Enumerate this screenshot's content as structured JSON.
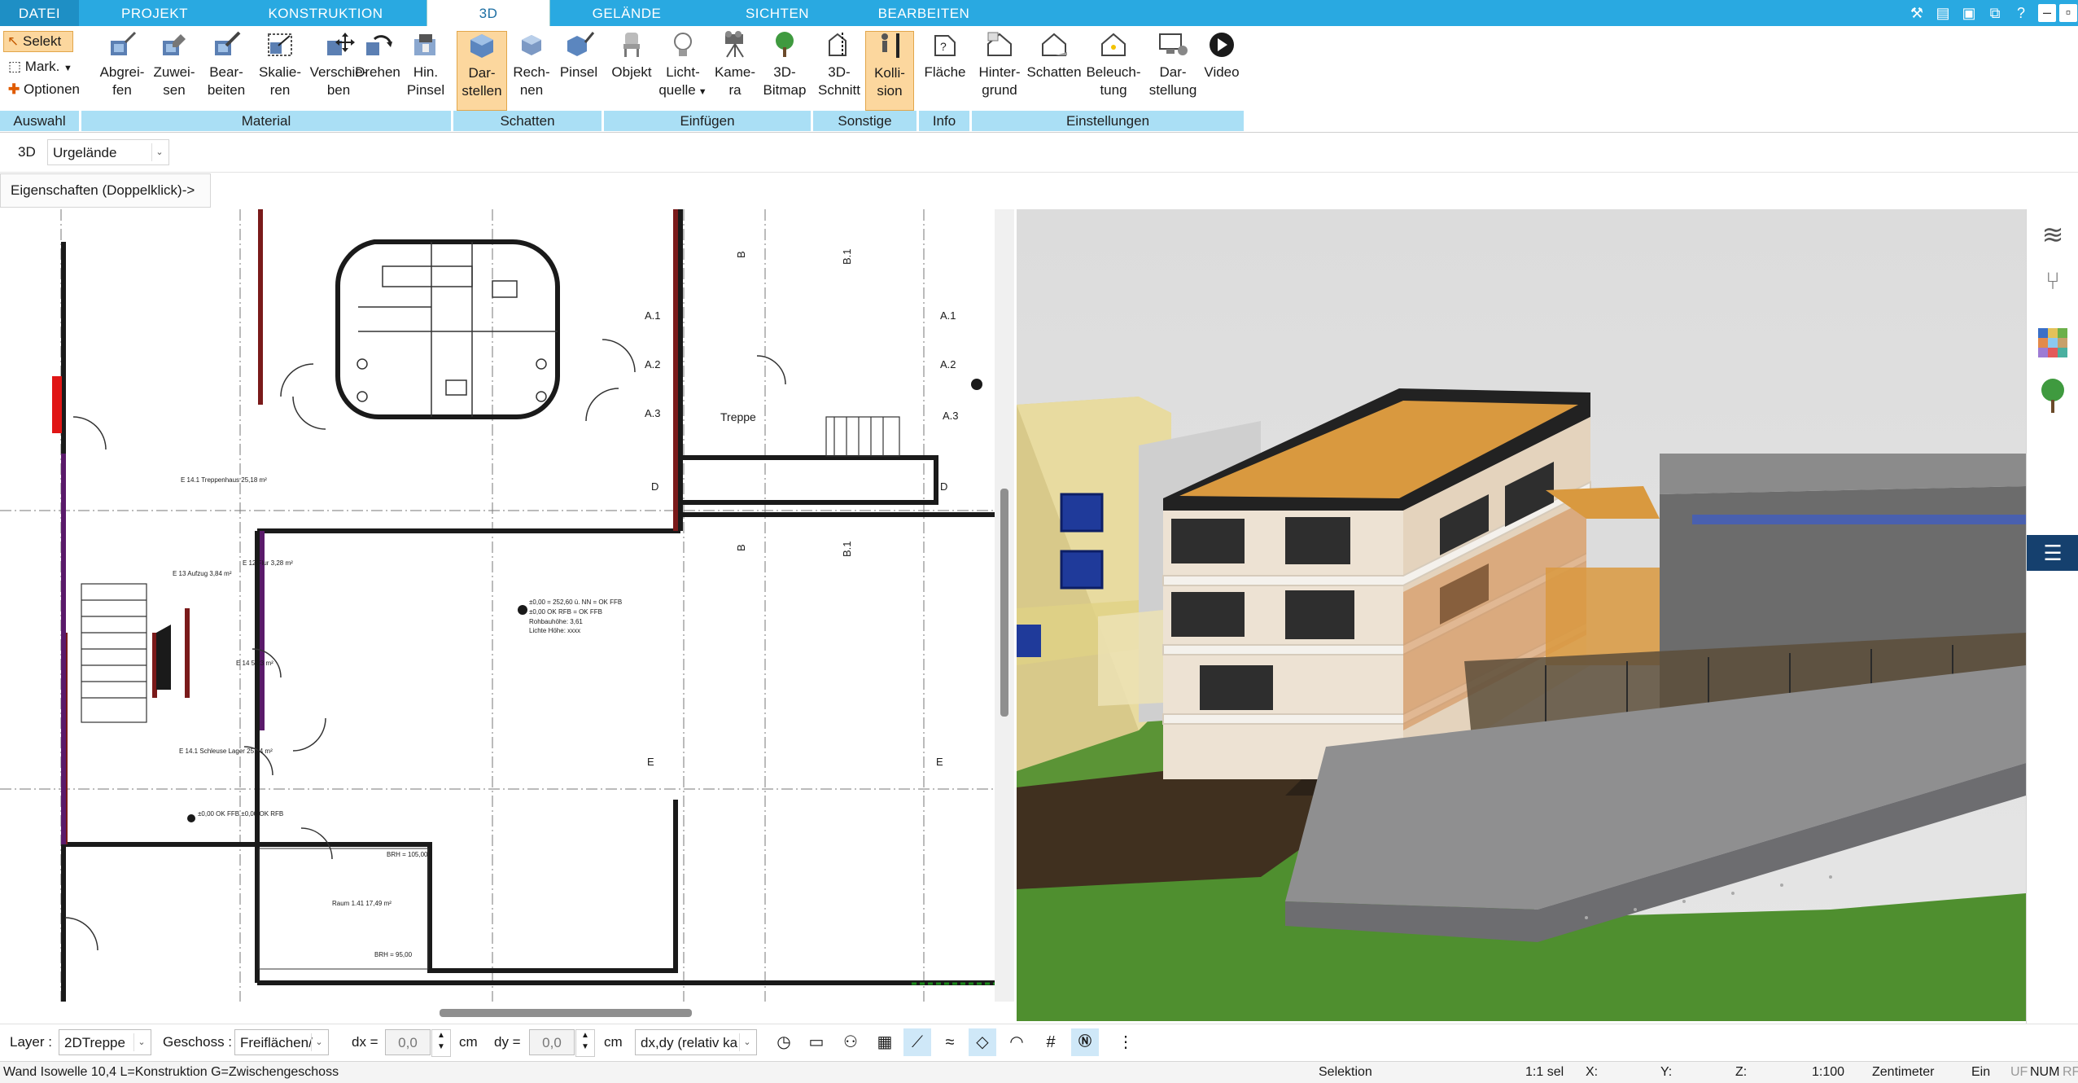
{
  "menu": {
    "tabs": [
      "DATEI",
      "PROJEKT",
      "KONSTRUKTION",
      "3D",
      "GELÄNDE",
      "SICHTEN",
      "BEARBEITEN"
    ]
  },
  "ribbon": {
    "auswahl": {
      "label": "Auswahl",
      "select": "Selekt",
      "mark": "Mark.",
      "options": "Optionen"
    },
    "material": {
      "label": "Material",
      "buttons": [
        {
          "line1": "Abgrei-",
          "line2": "fen"
        },
        {
          "line1": "Zuwei-",
          "line2": "sen"
        },
        {
          "line1": "Bear-",
          "line2": "beiten"
        },
        {
          "line1": "Skalie-",
          "line2": "ren"
        },
        {
          "line1": "Verschie-",
          "line2": "ben"
        },
        {
          "line1": "Drehen",
          "line2": ""
        },
        {
          "line1": "Hin.",
          "line2": "Pinsel"
        }
      ]
    },
    "schatten": {
      "label": "Schatten",
      "buttons": [
        {
          "line1": "Dar-",
          "line2": "stellen"
        },
        {
          "line1": "Rech-",
          "line2": "nen"
        },
        {
          "line1": "Pinsel",
          "line2": ""
        }
      ]
    },
    "einfuegen": {
      "label": "Einfügen",
      "buttons": [
        {
          "line1": "Objekt",
          "line2": ""
        },
        {
          "line1": "Licht-",
          "line2": "quelle"
        },
        {
          "line1": "Kame-",
          "line2": "ra"
        },
        {
          "line1": "3D-",
          "line2": "Bitmap"
        }
      ]
    },
    "sonstige": {
      "label": "Sonstige",
      "buttons": [
        {
          "line1": "3D-",
          "line2": "Schnitt"
        },
        {
          "line1": "Kolli-",
          "line2": "sion"
        }
      ]
    },
    "info": {
      "label": "Info",
      "buttons": [
        {
          "line1": "Fläche",
          "line2": ""
        }
      ]
    },
    "einstellungen": {
      "label": "Einstellungen",
      "buttons": [
        {
          "line1": "Hinter-",
          "line2": "grund"
        },
        {
          "line1": "Schatten",
          "line2": ""
        },
        {
          "line1": "Beleuch-",
          "line2": "tung"
        },
        {
          "line1": "Dar-",
          "line2": "stellung"
        },
        {
          "line1": "Video",
          "line2": ""
        }
      ]
    }
  },
  "subbar": {
    "mode": "3D",
    "terrain": "Urgelände"
  },
  "properties_hint": "Eigenschaften (Doppelklick)->",
  "plan": {
    "labels": {
      "treppe": "Treppe",
      "a1": "A.1",
      "a2": "A.2",
      "a3": "A.3",
      "b": "B",
      "b1": "B.1",
      "d": "D",
      "e": "E",
      "room1": "Raum 1.41\n17,49 m²",
      "elev1": "±0,00 = 252,60 ü. NN = OK FFB",
      "elev2": "±0,00 OK RFB = OK FFB",
      "elev3": "Rohbauhöhe: 3,61",
      "elev4": "Lichte Höhe: xxxx",
      "schleuse": "E 14.1\nSchleuse Lager\n25,44 m²",
      "aufzug": "E 13\nAufzug\n3,84 m²",
      "treppenhaus": "E 14.1\nTreppenhaus\n25,18 m²",
      "flur": "E 12\nFlur\n3,28 m²",
      "e14": "E 14\n5,23 m²",
      "ok_ffb": "±0,00 OK FFB\n±0,00 OK RFB",
      "brh_top": "BRH = 105,00",
      "brh_bottom": "BRH = 95,00"
    }
  },
  "toolbar": {
    "layer_label": "Layer :",
    "layer_value": "2DTreppe",
    "geschoss_label": "Geschoss :",
    "geschoss_value": "Freiflächen/",
    "dx_label": "dx =",
    "dx_value": "0,0",
    "dx_unit": "cm",
    "dy_label": "dy =",
    "dy_value": "0,0",
    "dy_unit": "cm",
    "mode_value": "dx,dy (relativ ka"
  },
  "status": {
    "left": "Wand Isowelle 10,4 L=Konstruktion G=Zwischengeschoss",
    "mode": "Selektion",
    "ratio": "1:1 sel",
    "x": "X:",
    "y": "Y:",
    "z": "Z:",
    "scale": "1:100",
    "unit": "Zentimeter",
    "ein": "Ein",
    "uf": "UF",
    "num": "NUM",
    "rf": "RF"
  },
  "colors": {
    "accent": "#29a9e1",
    "ribbon_group": "#aadff5",
    "active_button": "#fcd79e",
    "grass": "#4f8f2f",
    "roof": "#d9993f"
  }
}
